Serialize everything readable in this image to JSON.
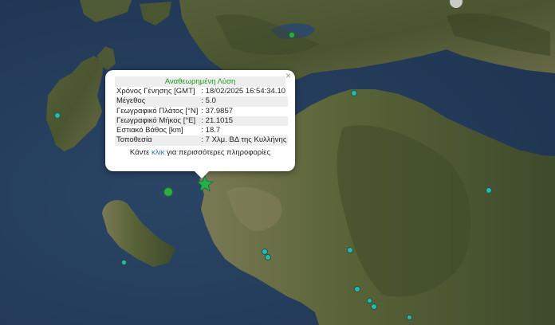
{
  "map": {
    "colors": {
      "sea": "#243c59",
      "land_dark": "#3b4a2a",
      "land_light": "#6b7048",
      "marker": "#2fb7a9",
      "star": "#22b14c"
    }
  },
  "popup": {
    "title": "Αναθεωρημένη Λύση",
    "close": "×",
    "rows": [
      {
        "label": "Χρόνος Γένησης [GMT]",
        "value": ": 18/02/2025 16:54:34.10"
      },
      {
        "label": "Μέγεθος",
        "value": ": 5.0"
      },
      {
        "label": "Γεωγραφικό Πλάτος [°N]",
        "value": ": 37.9857"
      },
      {
        "label": "Γεωγραφικό Μήκος [°E]",
        "value": ": 21.1015"
      },
      {
        "label": "Εστιακό Βάθος [km]",
        "value": ": 18.7"
      },
      {
        "label": "Τοποθεσία",
        "value": ": 7 Χλμ. ΒΔ της Κυλλήνης"
      }
    ],
    "footer_pre": "Κάντε ",
    "footer_link": "κλικ",
    "footer_post": " για περισσότερες πληροφορίες"
  },
  "markers": {
    "epicenter_icon": "star-icon"
  }
}
